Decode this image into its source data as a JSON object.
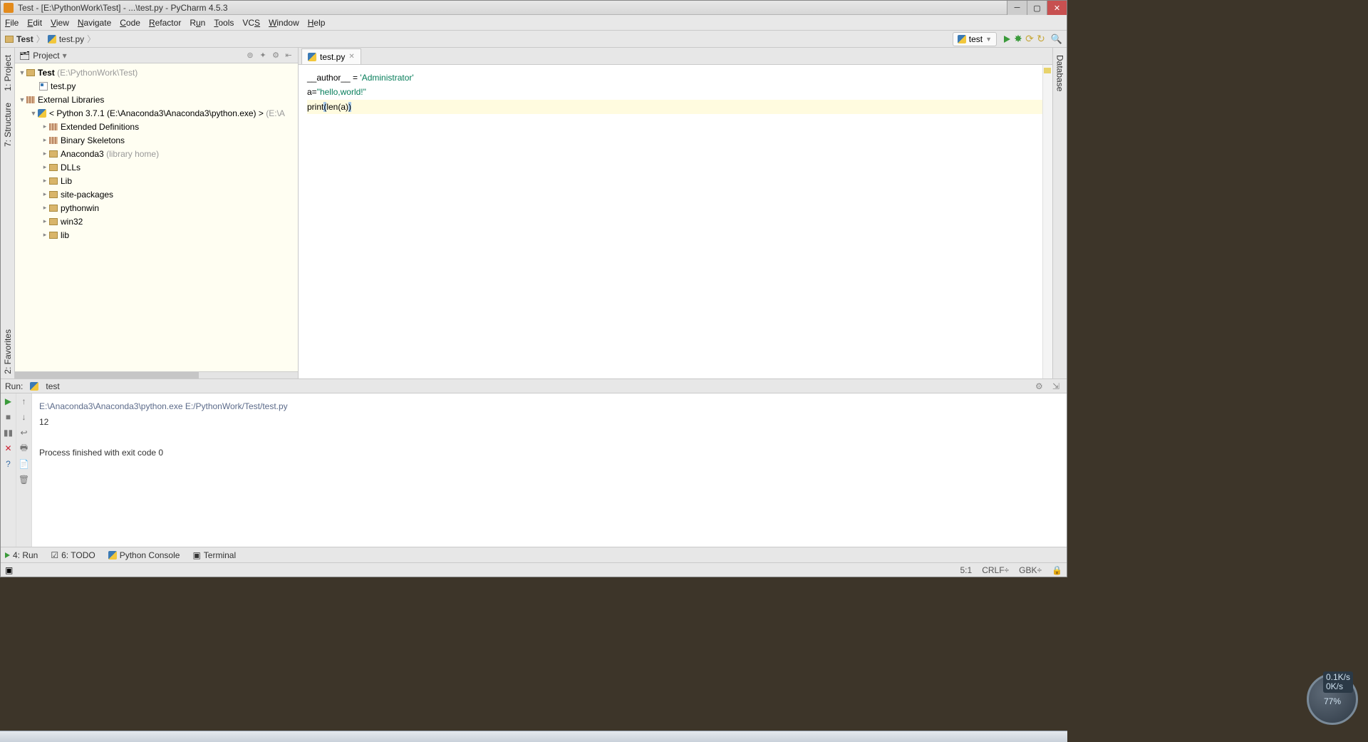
{
  "title": "Test - [E:\\PythonWork\\Test] - ...\\test.py - PyCharm 4.5.3",
  "menu": [
    "File",
    "Edit",
    "View",
    "Navigate",
    "Code",
    "Refactor",
    "Run",
    "Tools",
    "VCS",
    "Window",
    "Help"
  ],
  "breadcrumb": {
    "root": "Test",
    "file": "test.py"
  },
  "run_config": "test",
  "left_tabs": {
    "project": "1: Project",
    "structure": "7: Structure",
    "favorites": "2: Favorites"
  },
  "right_tabs": {
    "database": "Database"
  },
  "project_panel_title": "Project",
  "tree": {
    "root_name": "Test",
    "root_path": "(E:\\PythonWork\\Test)",
    "root_file": "test.py",
    "ext_lib": "External Libraries",
    "python_env": "< Python 3.7.1 (E:\\Anaconda3\\Anaconda3\\python.exe) >",
    "python_env_suffix": "(E:\\A",
    "children": [
      "Extended Definitions",
      "Binary Skeletons",
      "Anaconda3",
      "DLLs",
      "Lib",
      "site-packages",
      "pythonwin",
      "win32",
      "lib"
    ],
    "anaconda_suffix": "(library home)"
  },
  "editor_tab": "test.py",
  "code": {
    "l1a": "__author__ = ",
    "l1b": "'Administrator'",
    "l2a": "a=",
    "l2b": "\"hello,world!\"",
    "l3a": "print",
    "l3p1": "(",
    "l3b": "len(a)",
    "l3p2": ")"
  },
  "run_panel": {
    "label": "Run:",
    "name": "test"
  },
  "console": {
    "cmd": "E:\\Anaconda3\\Anaconda3\\python.exe E:/PythonWork/Test/test.py",
    "out": "12",
    "exit": "Process finished with exit code 0"
  },
  "toolwins": {
    "run": "4: Run",
    "todo": "6: TODO",
    "pyconsole": "Python Console",
    "terminal": "Terminal"
  },
  "status": {
    "pos": "5:1",
    "eol": "CRLF÷",
    "enc": "GBK÷"
  },
  "widget": {
    "val": "77",
    "unit": "%",
    "net1": "0.1K/s",
    "net2": "0K/s"
  }
}
